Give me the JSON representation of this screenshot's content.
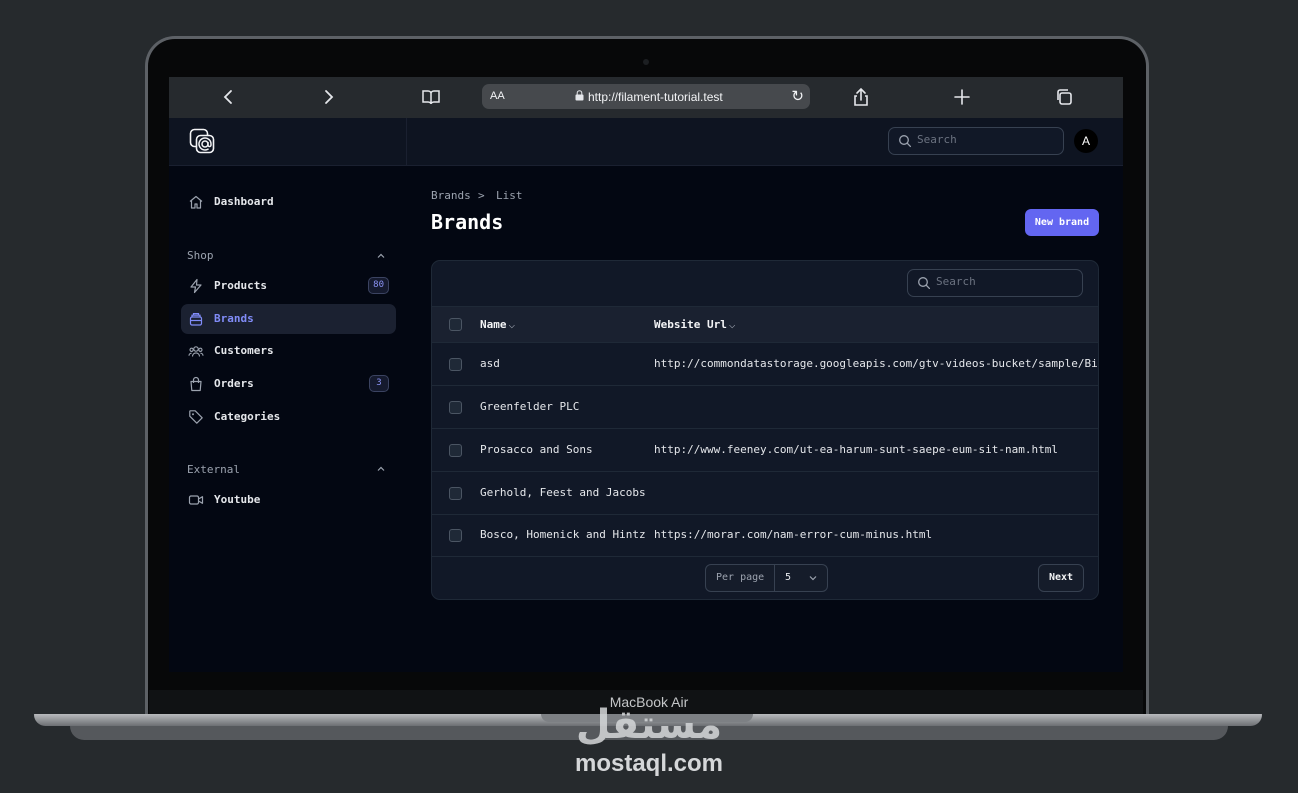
{
  "device": {
    "model": "MacBook Air"
  },
  "watermark": {
    "arabic": "مستقل",
    "latin": "mostaql.com"
  },
  "browser": {
    "reader_label": "AA",
    "url": "http://filament-tutorial.test",
    "icons": [
      "chevron-left-icon",
      "chevron-right-icon",
      "book-icon",
      "lock-icon",
      "reload-icon",
      "share-icon",
      "plus-icon",
      "tabs-icon"
    ]
  },
  "topbar": {
    "search_placeholder": "Search",
    "avatar_initial": "A"
  },
  "sidebar": {
    "dashboard": {
      "label": "Dashboard"
    },
    "shop": {
      "label": "Shop",
      "items": [
        {
          "label": "Products",
          "badge": "80",
          "icon": "bolt-icon"
        },
        {
          "label": "Brands",
          "icon": "box-icon",
          "active": true
        },
        {
          "label": "Customers",
          "icon": "users-icon"
        },
        {
          "label": "Orders",
          "badge": "3",
          "icon": "shopping-bag-icon"
        },
        {
          "label": "Categories",
          "icon": "tag-icon"
        }
      ]
    },
    "external": {
      "label": "External",
      "items": [
        {
          "label": "Youtube",
          "icon": "video-icon"
        }
      ]
    }
  },
  "page": {
    "breadcrumbs": [
      "Brands",
      "List"
    ],
    "breadcrumb_separator": ">",
    "title": "Brands",
    "new_button": "New brand"
  },
  "table": {
    "search_placeholder": "Search",
    "columns": [
      {
        "label": "Name",
        "sort_indicator": "⌵"
      },
      {
        "label": "Website Url",
        "sort_indicator": "⌵"
      }
    ],
    "rows": [
      {
        "name": "asd",
        "url": "http://commondatastorage.googleapis.com/gtv-videos-bucket/sample/BigBuc"
      },
      {
        "name": "Greenfelder PLC",
        "url": ""
      },
      {
        "name": "Prosacco and Sons",
        "url": "http://www.feeney.com/ut-ea-harum-sunt-saepe-eum-sit-nam.html"
      },
      {
        "name": "Gerhold, Feest and Jacobs",
        "url": ""
      },
      {
        "name": "Bosco, Homenick and Hintz",
        "url": "https://morar.com/nam-error-cum-minus.html"
      }
    ],
    "pagination": {
      "per_page_label": "Per page",
      "per_page_value": "5",
      "next_label": "Next"
    }
  },
  "colors": {
    "accent": "#6366f1",
    "accent_text": "#818cf8",
    "background": "#030712",
    "panel": "#111827"
  }
}
